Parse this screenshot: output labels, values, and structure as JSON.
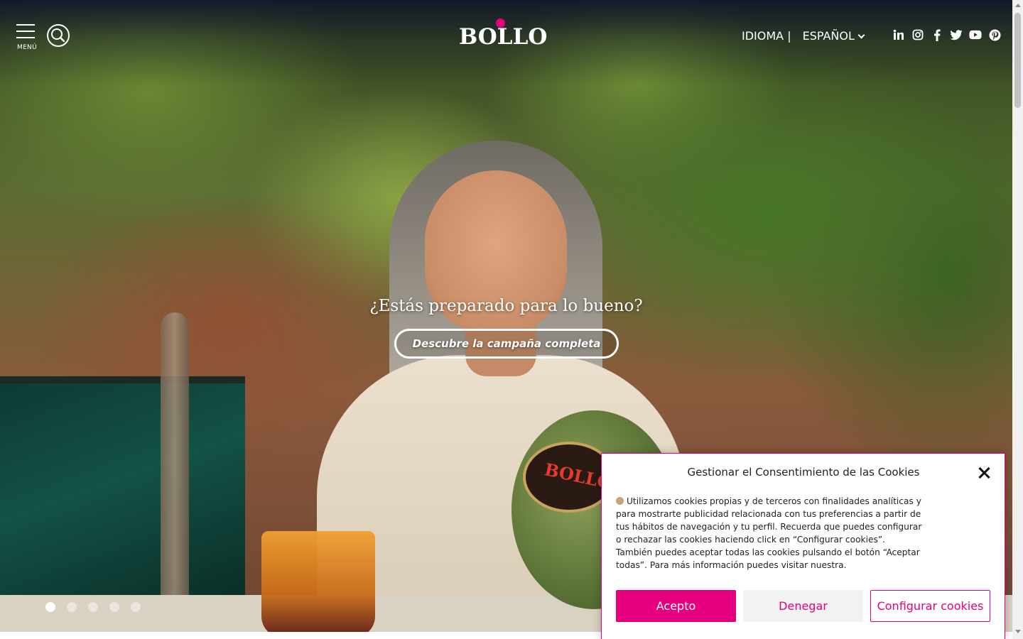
{
  "header": {
    "menu_label": "MENÚ",
    "logo_text": "BOLLO",
    "language_label": "IDIOMA |",
    "language_selected": "ESPAÑOL",
    "social_icons": [
      "linkedin-icon",
      "instagram-icon",
      "facebook-icon",
      "twitter-icon",
      "youtube-icon",
      "pinterest-icon"
    ]
  },
  "hero": {
    "title": "¿Estás preparado para lo bueno?",
    "cta_label": "Descubre la campaña completa",
    "melon_label": "BOLLO",
    "slides_count": 5,
    "active_slide": 1
  },
  "cookie_banner": {
    "title": "Gestionar el Consentimiento de las Cookies",
    "text": "Utilizamos cookies propias y de terceros con finalidades analíticas y para mostrarte publicidad relacionada con tus preferencias a partir de tus hábitos de navegación y tu perfil. Recuerda que puedes configurar o rechazar las cookies haciendo click en “Configurar cookies”. También puedes aceptar todas las cookies pulsando el botón “Aceptar todas”. Para más información puedes visitar nuestra.",
    "accept_label": "Acepto",
    "deny_label": "Denegar",
    "configure_label": "Configurar cookies"
  },
  "colors": {
    "brand_pink": "#e6007e",
    "header_shade": "#12162c",
    "white": "#ffffff"
  }
}
